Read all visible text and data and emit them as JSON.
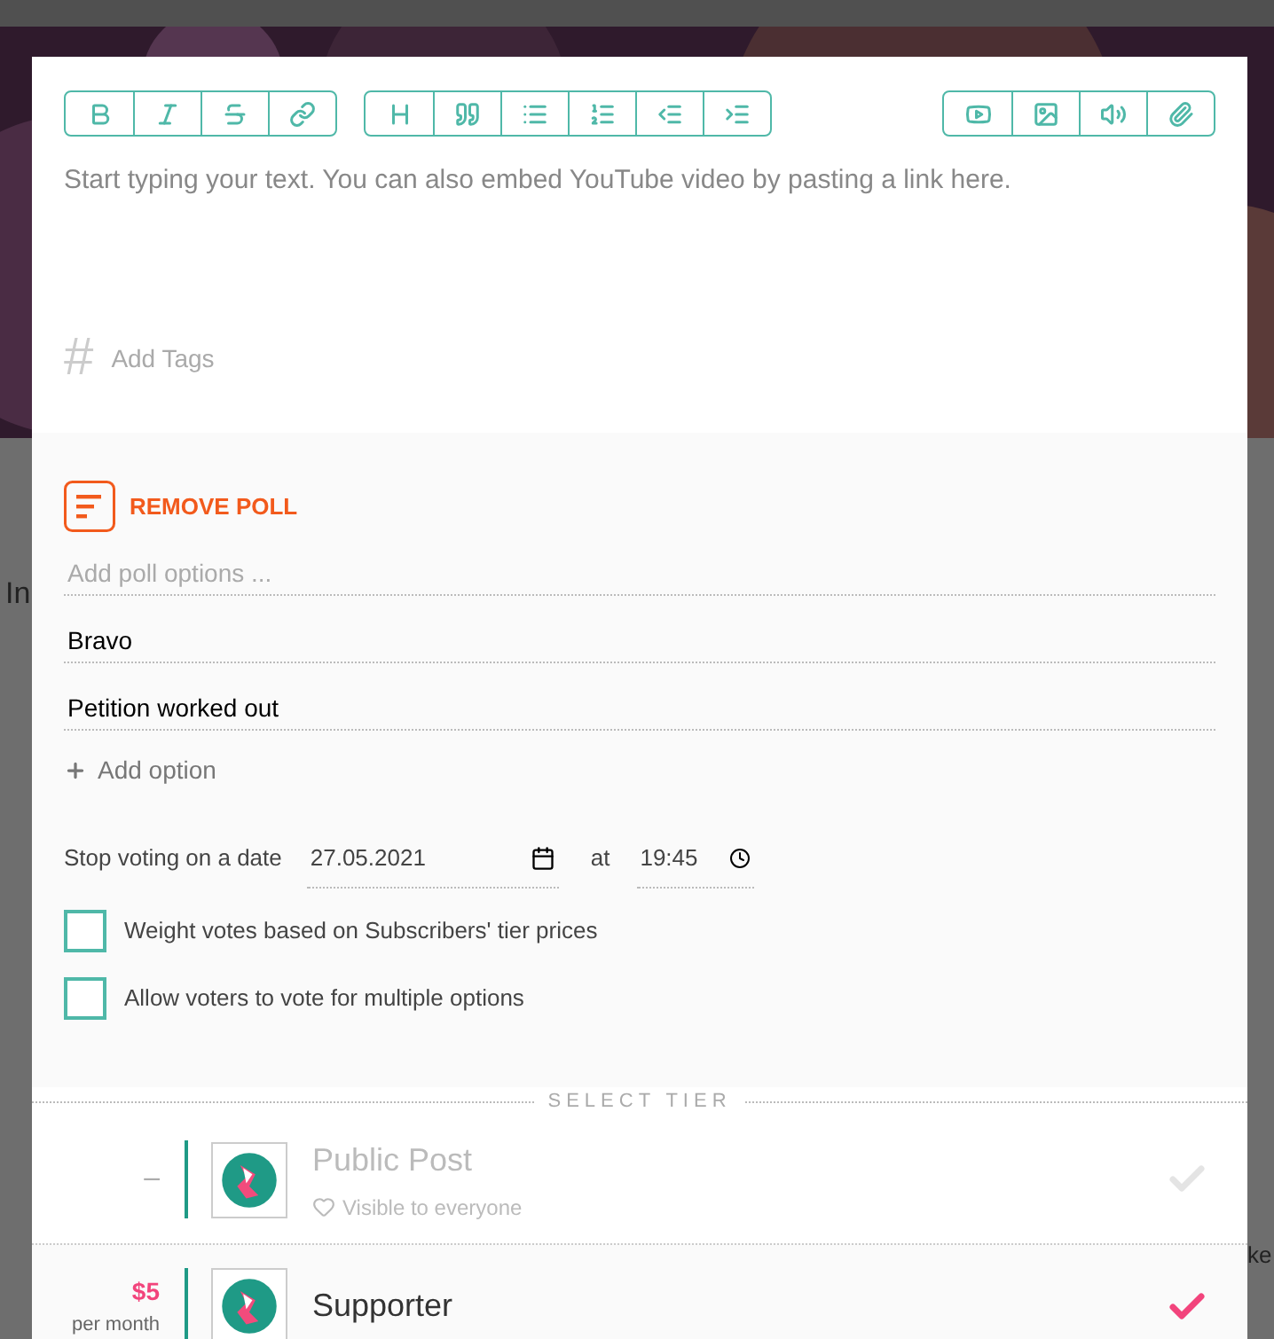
{
  "background": {
    "text_fragment": "In",
    "right_fragment": "ke"
  },
  "editor": {
    "placeholder": "Start typing your text. You can also embed YouTube video by pasting a link here.",
    "tags_icon": "#",
    "tags_placeholder": "Add Tags"
  },
  "poll": {
    "remove_label": "REMOVE POLL",
    "options_placeholder": "Add poll options ...",
    "options": [
      "Bravo",
      "Petition worked out"
    ],
    "add_option": "Add option",
    "stop_label": "Stop voting on a date",
    "date": "27.05.2021",
    "at": "at",
    "time": "19:45",
    "checkboxes": [
      {
        "label": "Weight votes based on Subscribers' tier prices",
        "checked": false
      },
      {
        "label": "Allow voters to vote for multiple options",
        "checked": false
      }
    ]
  },
  "tiers": {
    "heading": "SELECT TIER",
    "items": [
      {
        "price": "–",
        "name": "Public Post",
        "subtitle": "Visible to everyone",
        "selected": false
      },
      {
        "price": "$5",
        "period": "per month",
        "name": "Supporter",
        "selected": true
      }
    ]
  }
}
